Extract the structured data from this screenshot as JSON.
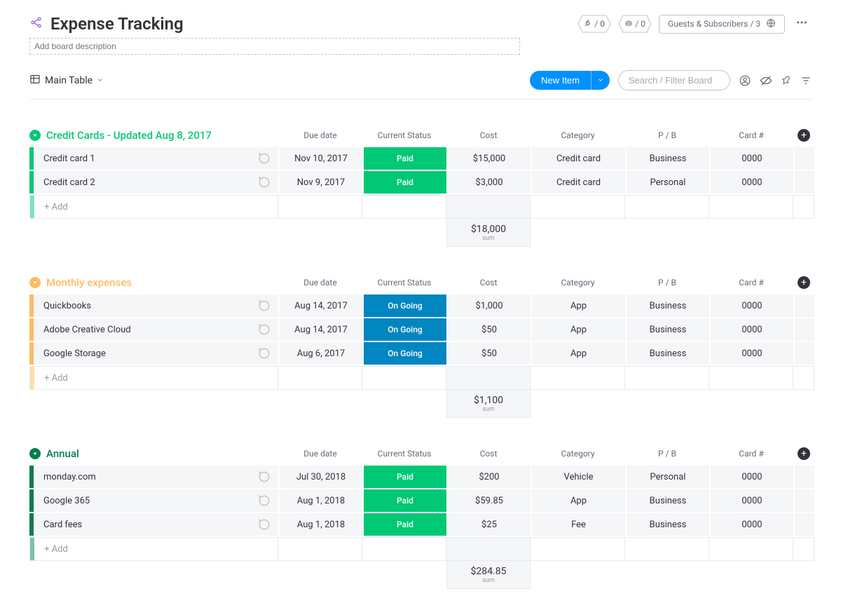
{
  "header": {
    "title": "Expense Tracking",
    "desc_placeholder": "Add board description",
    "integrations_count": "/ 0",
    "automations_count": "/ 0",
    "guests_label": "Guests & Subscribers / 3"
  },
  "toolbar": {
    "view_label": "Main Table",
    "new_item_label": "New Item",
    "search_placeholder": "Search / Filter Board"
  },
  "columns": [
    "Due date",
    "Current Status",
    "Cost",
    "Category",
    "P / B",
    "Card #"
  ],
  "add_row_label": "+ Add",
  "sum_label": "sum",
  "groups": [
    {
      "id": "credit",
      "color_class": "grp-green",
      "title": "Credit Cards - Updated Aug 8, 2017",
      "rows": [
        {
          "name": "Credit card 1",
          "due": "Nov 10, 2017",
          "status": "Paid",
          "status_class": "status-paid",
          "cost": "$15,000",
          "category": "Credit card",
          "pb": "Business",
          "card": "0000"
        },
        {
          "name": "Credit card 2",
          "due": "Nov 9, 2017",
          "status": "Paid",
          "status_class": "status-paid",
          "cost": "$3,000",
          "category": "Credit card",
          "pb": "Personal",
          "card": "0000"
        }
      ],
      "sum": "$18,000"
    },
    {
      "id": "monthly",
      "color_class": "grp-yellow",
      "title": "Monthly expenses",
      "rows": [
        {
          "name": "Quickbooks",
          "due": "Aug 14, 2017",
          "status": "On Going",
          "status_class": "status-ongoing",
          "cost": "$1,000",
          "category": "App",
          "pb": "Business",
          "card": "0000"
        },
        {
          "name": "Adobe Creative Cloud",
          "due": "Aug 14, 2017",
          "status": "On Going",
          "status_class": "status-ongoing",
          "cost": "$50",
          "category": "App",
          "pb": "Business",
          "card": "0000"
        },
        {
          "name": "Google Storage",
          "due": "Aug 6, 2017",
          "status": "On Going",
          "status_class": "status-ongoing",
          "cost": "$50",
          "category": "App",
          "pb": "Business",
          "card": "0000"
        }
      ],
      "sum": "$1,100"
    },
    {
      "id": "annual",
      "color_class": "grp-darkgreen",
      "title": "Annual",
      "rows": [
        {
          "name": "monday.com",
          "due": "Jul 30, 2018",
          "status": "Paid",
          "status_class": "status-paid",
          "cost": "$200",
          "category": "Vehicle",
          "pb": "Personal",
          "card": "0000"
        },
        {
          "name": "Google 365",
          "due": "Aug 1, 2018",
          "status": "Paid",
          "status_class": "status-paid",
          "cost": "$59.85",
          "category": "App",
          "pb": "Business",
          "card": "0000"
        },
        {
          "name": "Card fees",
          "due": "Aug 1, 2018",
          "status": "Paid",
          "status_class": "status-paid",
          "cost": "$25",
          "category": "Fee",
          "pb": "Business",
          "card": "0000"
        }
      ],
      "sum": "$284.85"
    }
  ]
}
